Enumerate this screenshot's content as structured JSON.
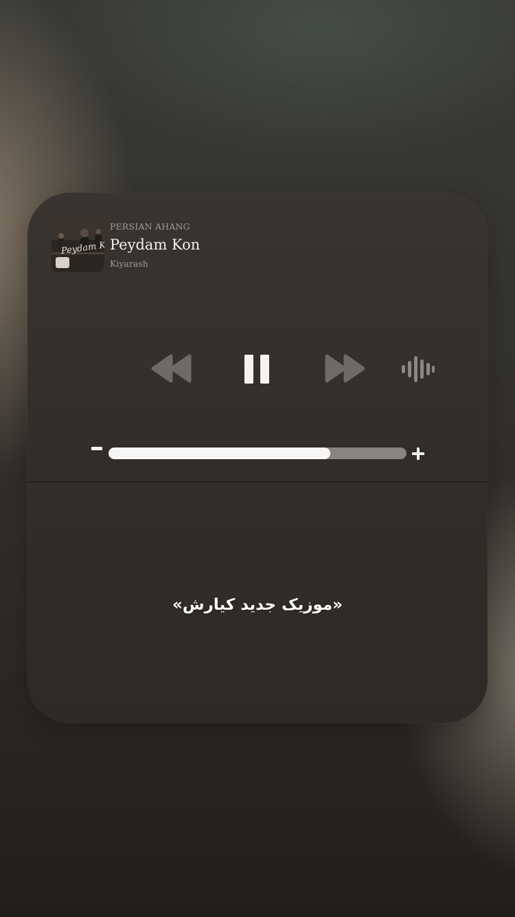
{
  "now_playing": {
    "source": "PERSIAN AHANG",
    "title": "Peydam Kon",
    "artist": "Kiyarash",
    "artwork": {
      "script_text": "Peydam Kon",
      "icon": "album-art"
    }
  },
  "controls": {
    "rewind_icon": "rewind-icon",
    "pause_icon": "pause-icon",
    "forward_icon": "fast-forward-icon",
    "audio_icon": "audio-waveform-icon"
  },
  "volume": {
    "minus": "-",
    "plus": "+",
    "level": 0.745
  },
  "caption": "«موزیک جدید کیارش»",
  "colors": {
    "control_inactive": "#6f6a66",
    "control_active": "#f5f3f1",
    "slider_fill": "#f7f6f5",
    "slider_track": "#a7a29e"
  }
}
